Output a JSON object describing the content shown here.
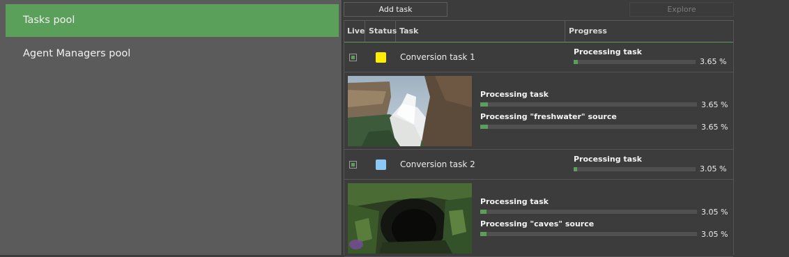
{
  "sidebar": {
    "items": [
      {
        "label": "Tasks pool",
        "active": true
      },
      {
        "label": "Agent Managers pool",
        "active": false
      }
    ]
  },
  "toolbar": {
    "add_task_label": "Add task",
    "explore_label": "Explore"
  },
  "grid": {
    "columns": {
      "live": "Live",
      "status": "Status",
      "task": "Task",
      "progress": "Progress"
    },
    "tasks": [
      {
        "name": "Conversion task 1",
        "live": true,
        "status_color": "#ffee00",
        "progress_label": "Processing task",
        "progress_text": "3.65 %",
        "progress_fraction": 0.0365,
        "thumbnail": "waterfall-cliff-image",
        "details": [
          {
            "label": "Processing task",
            "text": "3.65 %",
            "fraction": 0.0365
          },
          {
            "label": "Processing \"freshwater\" source",
            "text": "3.65 %",
            "fraction": 0.0365
          }
        ]
      },
      {
        "name": "Conversion task 2",
        "live": true,
        "status_color": "#8cc8f5",
        "progress_label": "Processing task",
        "progress_text": "3.05 %",
        "progress_fraction": 0.0305,
        "thumbnail": "jungle-cave-image",
        "details": [
          {
            "label": "Processing task",
            "text": "3.05 %",
            "fraction": 0.0305
          },
          {
            "label": "Processing \"caves\" source",
            "text": "3.05 %",
            "fraction": 0.0305
          }
        ]
      }
    ]
  },
  "colors": {
    "accent": "#5a9f5a",
    "sidebar_bg": "#5b5b5b",
    "panel_bg": "#3c3c3c"
  }
}
